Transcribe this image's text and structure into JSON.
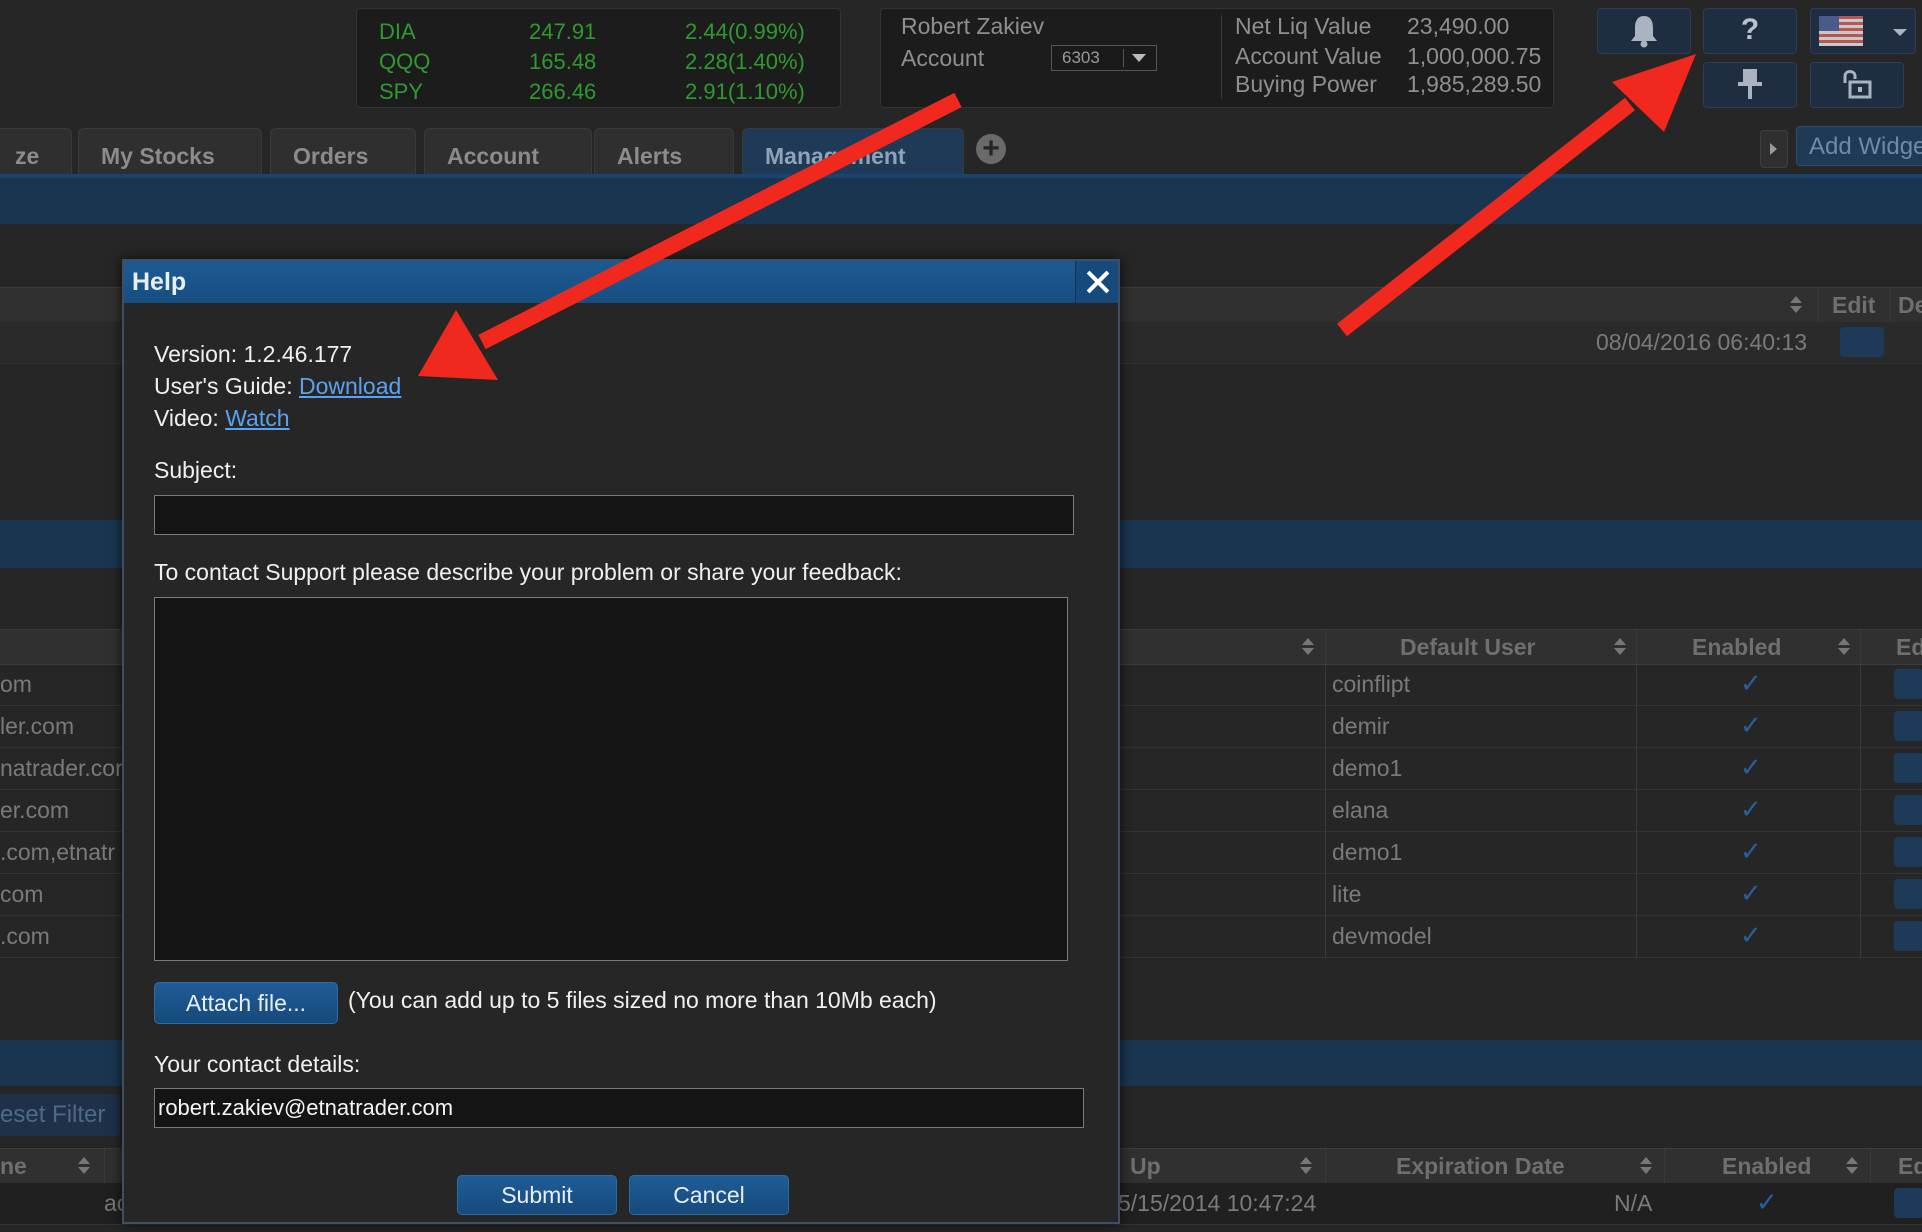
{
  "ticker": [
    {
      "symbol": "DIA",
      "price": "247.91",
      "change": "2.44(0.99%)"
    },
    {
      "symbol": "QQQ",
      "price": "165.48",
      "change": "2.28(1.40%)"
    },
    {
      "symbol": "SPY",
      "price": "266.46",
      "change": "2.91(1.10%)"
    }
  ],
  "account": {
    "user_name": "Robert Zakiev",
    "account_label": "Account",
    "account_number": "6303",
    "net_liq_label": "Net Liq Value",
    "net_liq_value": "23,490.00",
    "account_value_label": "Account Value",
    "account_value": "1,000,000.75",
    "buying_power_label": "Buying Power",
    "buying_power": "1,985,289.50"
  },
  "toolbar": {
    "bell_icon": "bell-icon",
    "help_label": "?",
    "flag_icon": "us-flag-icon",
    "pin_icon": "pin-icon",
    "unlock_icon": "unlock-icon",
    "add_widget_label": "Add Widge"
  },
  "tabs": [
    {
      "label": "ze"
    },
    {
      "label": "My Stocks"
    },
    {
      "label": "Orders"
    },
    {
      "label": "Account"
    },
    {
      "label": "Alerts"
    },
    {
      "label": "Management",
      "active": true
    }
  ],
  "grid1": {
    "headers": {
      "edit": "Edit",
      "de": "De"
    },
    "row_date": "08/04/2016 06:40:13"
  },
  "grid2": {
    "headers": {
      "default_user": "Default User",
      "enabled": "Enabled",
      "ed": "Ed"
    },
    "rows": [
      {
        "domain": "om",
        "user": "coinflipt",
        "enabled": "✓"
      },
      {
        "domain": "ler.com",
        "user": "demir",
        "enabled": "✓"
      },
      {
        "domain": "natrader.cor",
        "user": "demo1",
        "enabled": "✓"
      },
      {
        "domain": "er.com",
        "user": "elana",
        "enabled": "✓"
      },
      {
        "domain": ".com,etnatr",
        "user": "demo1",
        "enabled": "✓"
      },
      {
        "domain": "com",
        "user": "lite",
        "enabled": "✓"
      },
      {
        "domain": ".com",
        "user": "devmodel",
        "enabled": "✓"
      }
    ]
  },
  "grid3": {
    "reset_filter": "eset Filter",
    "headers": {
      "name": "ne",
      "up": "Up",
      "expiration": "Expiration Date",
      "enabled": "Enabled",
      "ed": "Ed"
    },
    "row": {
      "c1": "ac",
      "date": "5/15/2014 10:47:24",
      "expiration": "N/A",
      "enabled": "✓"
    }
  },
  "dialog": {
    "title": "Help",
    "version_label": "Version: ",
    "version_value": "1.2.46.177",
    "guide_label": "User's Guide: ",
    "guide_link": "Download",
    "video_label": "Video: ",
    "video_link": "Watch",
    "subject_label": "Subject:",
    "subject_value": "",
    "feedback_label": "To contact Support please describe your problem or share your feedback:",
    "feedback_value": "",
    "attach_button": "Attach file...",
    "attach_note": "(You can add up to 5 files sized no more than 10Mb each)",
    "contact_label": "Your contact details:",
    "contact_value": "robert.zakiev@etnatrader.com",
    "submit_button": "Submit",
    "cancel_button": "Cancel"
  },
  "colors": {
    "arrow": "#f0281e",
    "accent": "#1d5a93",
    "ticker_green": "#2f9a2f",
    "link": "#5aa2f0"
  }
}
